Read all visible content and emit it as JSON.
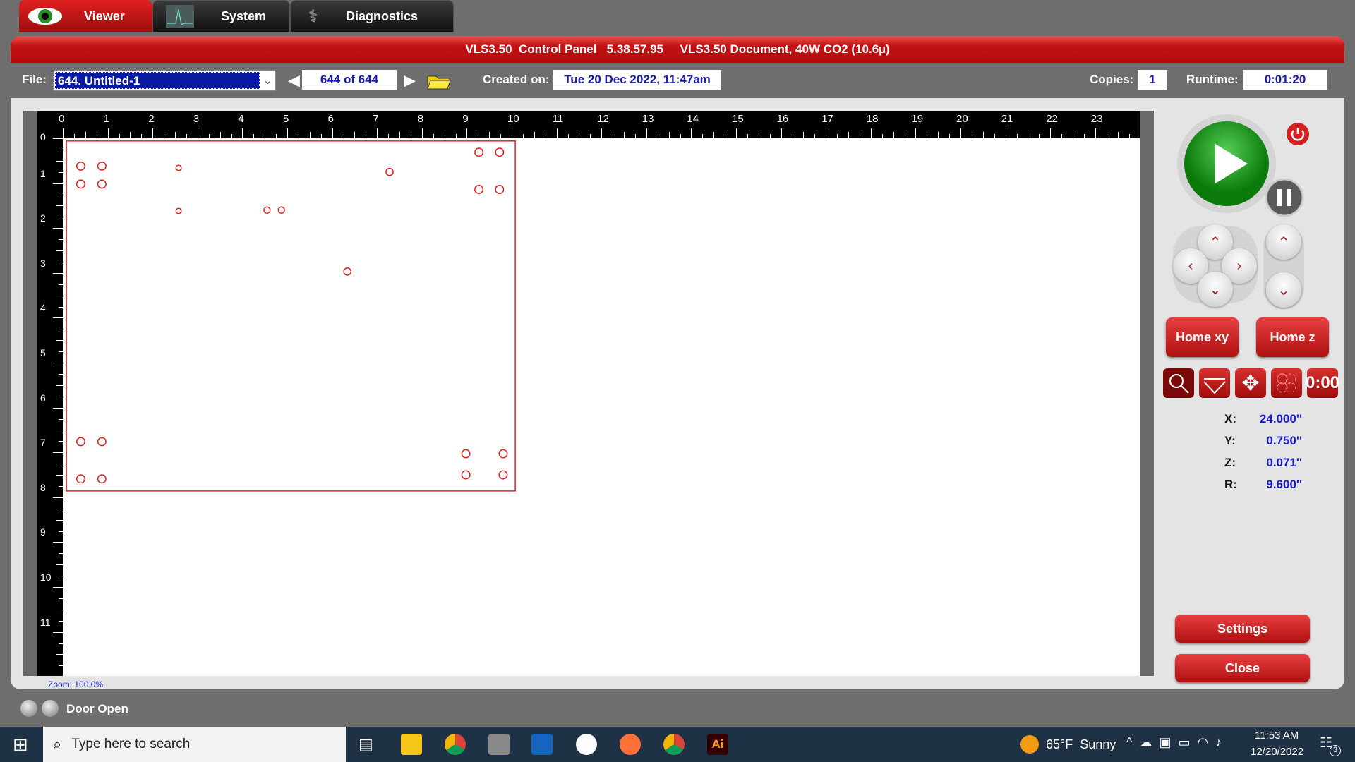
{
  "tabs": [
    {
      "label": "Viewer",
      "icon": "eye-icon",
      "active": true
    },
    {
      "label": "System",
      "icon": "waveform-icon"
    },
    {
      "label": "Diagnostics",
      "icon": "stethoscope-icon"
    }
  ],
  "title": "VLS3.50  Control Panel   5.38.57.95     VLS3.50 Document, 40W CO2 (10.6µ)",
  "file": {
    "label": "File:",
    "value": "644. Untitled-1",
    "counter": "644 of 644",
    "created_label": "Created on:",
    "created": "Tue 20 Dec 2022, 11:47am",
    "copies_label": "Copies:",
    "copies": "1",
    "runtime_label": "Runtime:",
    "runtime": "0:01:20"
  },
  "ruler": {
    "x_labels": [
      "0",
      "1",
      "2",
      "3",
      "4",
      "5",
      "6",
      "7",
      "8",
      "9",
      "10",
      "11",
      "12",
      "13",
      "14",
      "15",
      "16",
      "17",
      "18",
      "19",
      "20",
      "21",
      "22",
      "23"
    ],
    "y_labels": [
      "0",
      "1",
      "2",
      "3",
      "4",
      "5",
      "6",
      "7",
      "8",
      "9",
      "10",
      "11"
    ]
  },
  "document": {
    "units": "inch",
    "outline": {
      "w": 10.0,
      "h": 7.8,
      "color": "#e02020"
    },
    "circles": [
      [
        0.4,
        0.62,
        0.09
      ],
      [
        0.87,
        0.62,
        0.09
      ],
      [
        0.4,
        1.02,
        0.09
      ],
      [
        0.87,
        1.02,
        0.09
      ],
      [
        2.58,
        0.66,
        0.06
      ],
      [
        2.58,
        1.62,
        0.06
      ],
      [
        4.55,
        1.6,
        0.07
      ],
      [
        4.87,
        1.6,
        0.07
      ],
      [
        7.28,
        0.75,
        0.08
      ],
      [
        9.27,
        0.31,
        0.09
      ],
      [
        9.73,
        0.31,
        0.09
      ],
      [
        9.27,
        1.14,
        0.09
      ],
      [
        9.73,
        1.14,
        0.09
      ],
      [
        6.34,
        2.97,
        0.08
      ],
      [
        0.4,
        6.76,
        0.09
      ],
      [
        0.87,
        6.76,
        0.09
      ],
      [
        0.4,
        7.59,
        0.09
      ],
      [
        0.87,
        7.59,
        0.09
      ],
      [
        8.98,
        7.03,
        0.09
      ],
      [
        9.81,
        7.03,
        0.09
      ],
      [
        8.98,
        7.5,
        0.09
      ],
      [
        9.81,
        7.5,
        0.09
      ]
    ]
  },
  "zoom": "Zoom:  100.0%",
  "controls": {
    "home_xy": "Home xy",
    "home_z": "Home z",
    "timer": "0:00",
    "settings": "Settings",
    "close": "Close"
  },
  "coords": [
    {
      "k": "X:",
      "v": "24.000''"
    },
    {
      "k": "Y:",
      "v": "0.750''"
    },
    {
      "k": "Z:",
      "v": "0.071''"
    },
    {
      "k": "R:",
      "v": "9.600''"
    }
  ],
  "status": "Door Open",
  "taskbar": {
    "search_placeholder": "Type here to search",
    "weather": "65°F  Sunny",
    "time": "11:53 AM",
    "date": "12/20/2022",
    "notifications": "3"
  }
}
